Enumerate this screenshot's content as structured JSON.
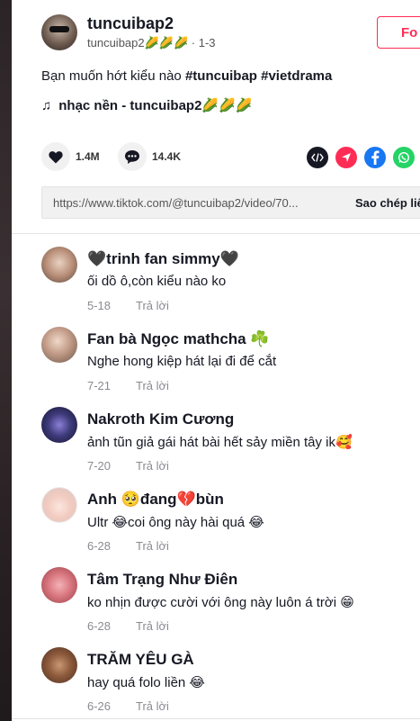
{
  "author": {
    "username": "tuncuibap2",
    "handle_line": "tuncuibap2🌽🌽🌽 · 1-3",
    "follow_label": "Fo"
  },
  "caption": {
    "text": "Bạn muốn hớt kiểu nào ",
    "tags": "#tuncuibap #vietdrama"
  },
  "music": {
    "icon": "♫",
    "label": "nhạc nền - tuncuibap2🌽🌽🌽"
  },
  "actions": {
    "likes": "1.4M",
    "comments": "14.4K"
  },
  "share_icons": [
    "embed-icon",
    "send-icon",
    "facebook-icon",
    "whatsapp-icon"
  ],
  "colors": {
    "accent": "#fe2c55",
    "facebook": "#1877f2",
    "whatsapp": "#25d366",
    "embed": "#161823"
  },
  "link": {
    "url": "https://www.tiktok.com/@tuncuibap2/video/70...",
    "copy_label": "Sao chép liên"
  },
  "comments": [
    {
      "name": "🖤trinh fan simmy🖤",
      "text": "ối dồ ô,còn kiểu nào ko",
      "date": "5-18",
      "reply": "Trả lời"
    },
    {
      "name": "Fan bà Ngọc mathcha ☘️",
      "text": "Nghe hong kiệp hát lại đi để cắt",
      "date": "7-21",
      "reply": "Trả lời"
    },
    {
      "name": "Nakroth Kim Cương",
      "text": "ảnh tũn giả gái hát bài hết sảy miền tây ik🥰",
      "date": "7-20",
      "reply": "Trả lời"
    },
    {
      "name": "Anh 🥺đang💔bùn",
      "text": "Ultr 😂coi ông này hài quá 😂",
      "date": "6-28",
      "reply": "Trả lời"
    },
    {
      "name": "Tâm Trạng Như Điên",
      "text": "ko nhịn được cười với ông này luôn á trời 😁",
      "date": "6-28",
      "reply": "Trả lời"
    },
    {
      "name": "TRĂM YÊU GÀ",
      "text": "hay quá folo liền 😂",
      "date": "6-26",
      "reply": "Trả lời"
    }
  ]
}
